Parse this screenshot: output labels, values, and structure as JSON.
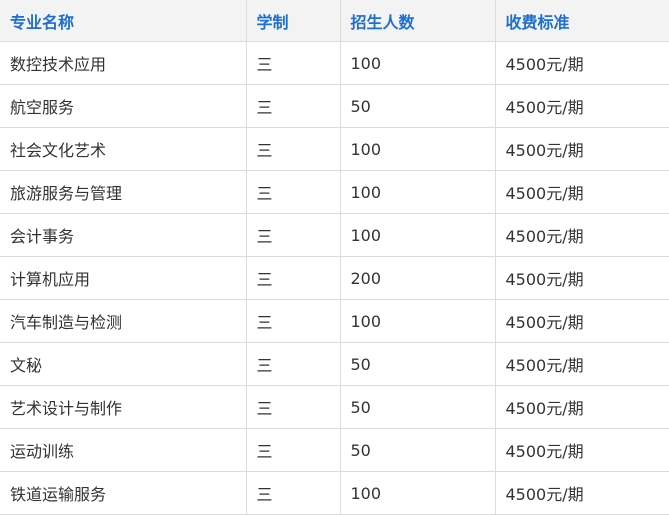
{
  "table": {
    "headers": [
      "专业名称",
      "学制",
      "招生人数",
      "收费标准"
    ],
    "rows": [
      [
        "数控技术应用",
        "三",
        "100",
        "4500元/期"
      ],
      [
        "航空服务",
        "三",
        "50",
        "4500元/期"
      ],
      [
        "社会文化艺术",
        "三",
        "100",
        "4500元/期"
      ],
      [
        "旅游服务与管理",
        "三",
        "100",
        "4500元/期"
      ],
      [
        "会计事务",
        "三",
        "100",
        "4500元/期"
      ],
      [
        "计算机应用",
        "三",
        "200",
        "4500元/期"
      ],
      [
        "汽车制造与检测",
        "三",
        "100",
        "4500元/期"
      ],
      [
        "文秘",
        "三",
        "50",
        "4500元/期"
      ],
      [
        "艺术设计与制作",
        "三",
        "50",
        "4500元/期"
      ],
      [
        "运动训练",
        "三",
        "50",
        "4500元/期"
      ],
      [
        "铁道运输服务",
        "三",
        "100",
        "4500元/期"
      ]
    ]
  },
  "colors": {
    "header_text": "#1e6fd0",
    "header_bg": "#f3f3f3",
    "border": "#dcdcdc",
    "cell_text": "#333333"
  }
}
